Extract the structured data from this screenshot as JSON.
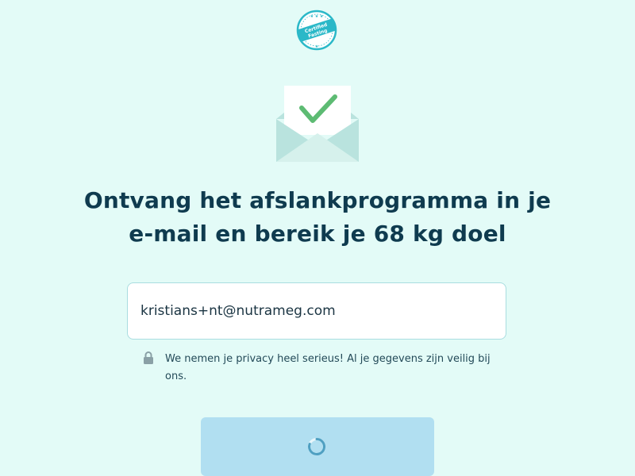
{
  "badge": {
    "line1": "Certified",
    "line2": "Fasting"
  },
  "headline": {
    "text": "Ontvang het afslankprogramma in je e-mail en bereik je 68 kg doel"
  },
  "email": {
    "value": "kristians+nt@nutrameg.com"
  },
  "privacy": {
    "text": "We nemen je privacy heel serieus! Al je gegevens zijn veilig bij ons."
  },
  "submit": {
    "state": "loading"
  },
  "colors": {
    "background": "#e3fbf7",
    "brand_teal": "#2bb8c8",
    "check_green": "#5dbb73",
    "button_disabled": "#b1dff1",
    "heading": "#0f3b4f"
  },
  "icons": {
    "logo": "certified-fasting-badge-icon",
    "envelope": "envelope-check-icon",
    "lock": "lock-icon",
    "spinner": "loading-spinner-icon"
  }
}
